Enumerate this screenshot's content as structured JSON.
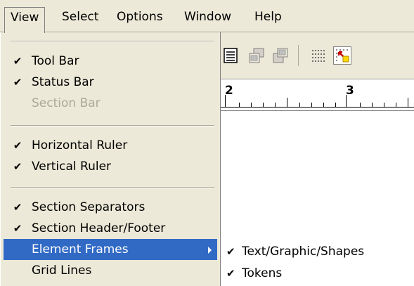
{
  "menubar": {
    "items": [
      {
        "label": "View",
        "open": true
      },
      {
        "label": "Select"
      },
      {
        "label": "Options"
      },
      {
        "label": "Window"
      },
      {
        "label": "Help"
      }
    ]
  },
  "ruler": {
    "numbers": [
      "2",
      "3"
    ]
  },
  "view_menu": {
    "items": [
      {
        "label": "Tool Bar",
        "checked": true
      },
      {
        "label": "Status Bar",
        "checked": true
      },
      {
        "label": "Section Bar",
        "checked": false,
        "disabled": true
      },
      {
        "label": "Horizontal Ruler",
        "checked": true
      },
      {
        "label": "Vertical Ruler",
        "checked": true
      },
      {
        "label": "Section Separators",
        "checked": true
      },
      {
        "label": "Section Header/Footer",
        "checked": true
      },
      {
        "label": "Element Frames",
        "checked": false,
        "highlighted": true,
        "submenu": true
      },
      {
        "label": "Grid Lines",
        "checked": false
      }
    ]
  },
  "element_frames_submenu": {
    "items": [
      {
        "label": "Text/Graphic/Shapes",
        "checked": true
      },
      {
        "label": "Tokens",
        "checked": true
      }
    ]
  },
  "icons": {
    "check": "✔"
  },
  "colors": {
    "menu_bg": "#ece9d8",
    "highlight_bg": "#316ac5",
    "disabled_text": "#aca899"
  }
}
